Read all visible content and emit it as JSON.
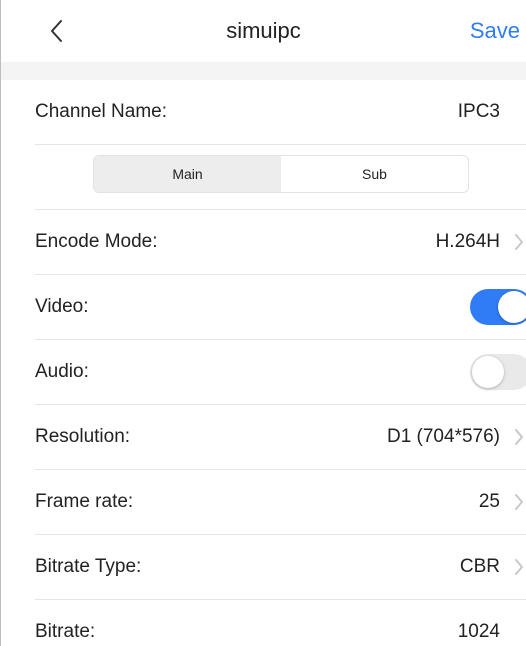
{
  "header": {
    "title": "simuipc",
    "save_label": "Save",
    "back_icon": "chevron-left-icon"
  },
  "channel": {
    "label": "Channel Name:",
    "value": "IPC3"
  },
  "stream_tabs": {
    "items": [
      {
        "label": "Main",
        "selected": true
      },
      {
        "label": "Sub",
        "selected": false
      }
    ]
  },
  "settings": {
    "encode_mode": {
      "label": "Encode Mode:",
      "value": "H.264H"
    },
    "video": {
      "label": "Video:",
      "enabled": true
    },
    "audio": {
      "label": "Audio:",
      "enabled": false
    },
    "resolution": {
      "label": "Resolution:",
      "value": "D1 (704*576)"
    },
    "frame_rate": {
      "label": "Frame rate:",
      "value": "25"
    },
    "bitrate_type": {
      "label": "Bitrate Type:",
      "value": "CBR"
    },
    "bitrate": {
      "label": "Bitrate:",
      "value": "1024"
    }
  },
  "colors": {
    "accent": "#2f7cf6",
    "toggle_off": "#e9e9ea",
    "segment_selected": "#ededed"
  }
}
